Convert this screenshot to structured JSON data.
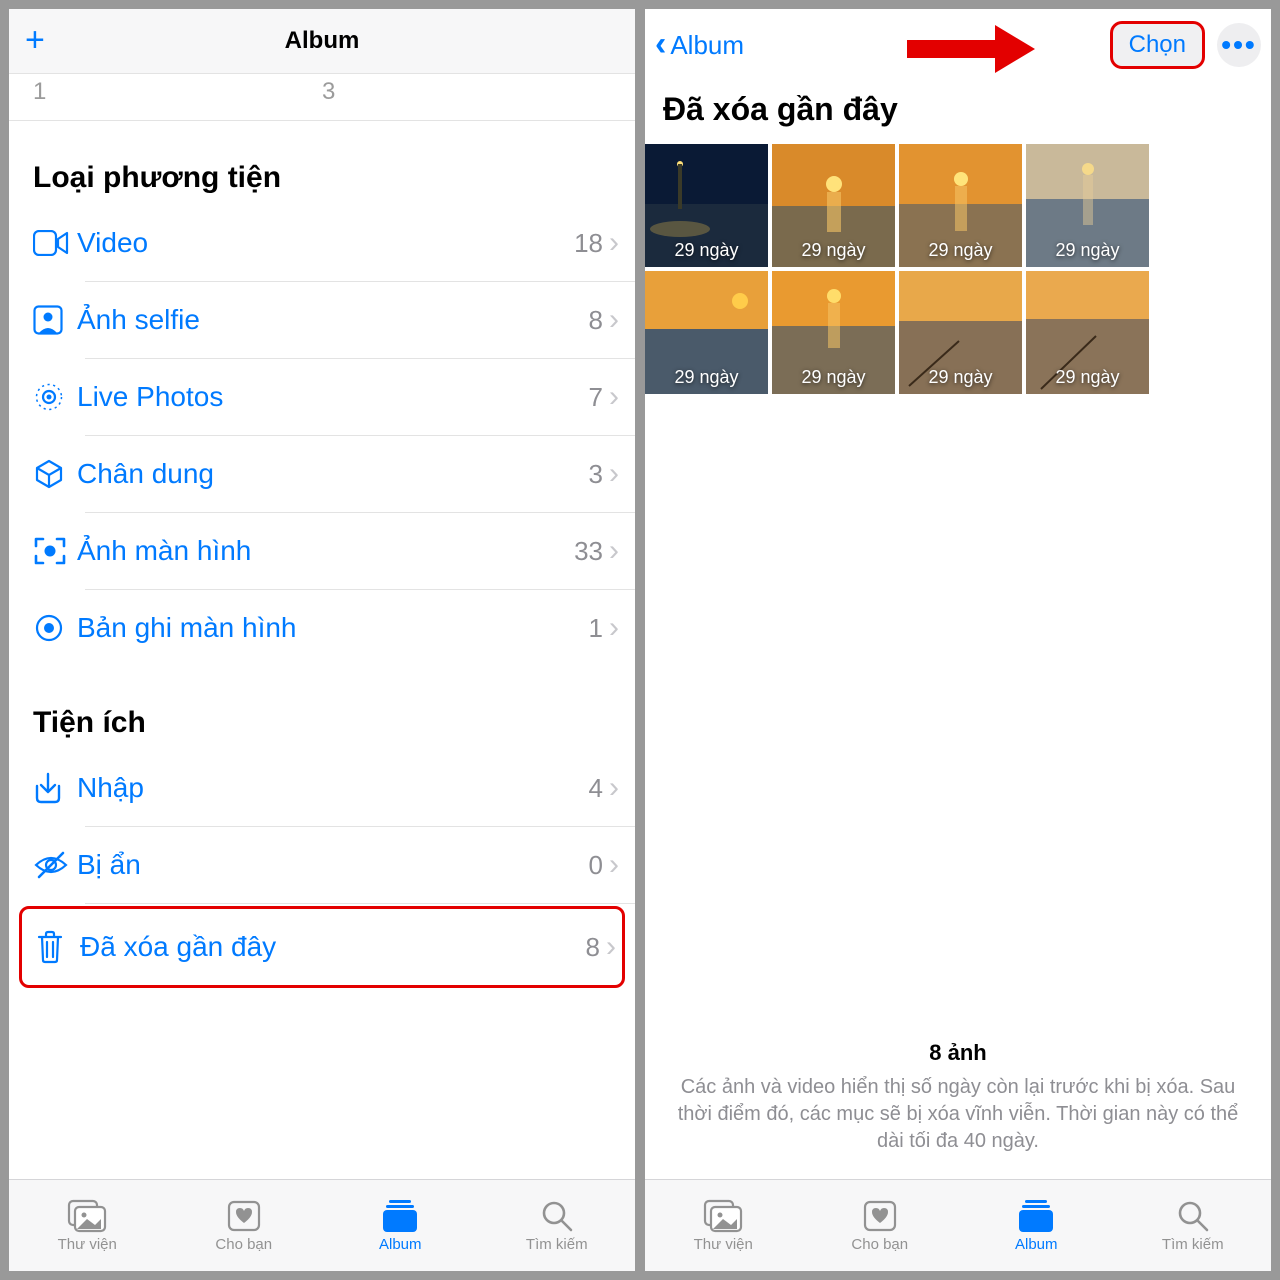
{
  "left": {
    "header_title": "Album",
    "row_small": {
      "a": "1",
      "b": "3"
    },
    "section_media": "Loại phương tiện",
    "media_rows": [
      {
        "label": "Video",
        "count": "18"
      },
      {
        "label": "Ảnh selfie",
        "count": "8"
      },
      {
        "label": "Live Photos",
        "count": "7"
      },
      {
        "label": "Chân dung",
        "count": "3"
      },
      {
        "label": "Ảnh màn hình",
        "count": "33"
      },
      {
        "label": "Bản ghi màn hình",
        "count": "1"
      }
    ],
    "section_util": "Tiện ích",
    "util_rows": [
      {
        "label": "Nhập",
        "count": "4"
      },
      {
        "label": "Bị ẩn",
        "count": "0"
      },
      {
        "label": "Đã xóa gần đây",
        "count": "8"
      }
    ]
  },
  "right": {
    "back_label": "Album",
    "select_label": "Chọn",
    "title": "Đã xóa gần đây",
    "thumbs": [
      "29 ngày",
      "29 ngày",
      "29 ngày",
      "29 ngày",
      "29 ngày",
      "29 ngày",
      "29 ngày",
      "29 ngày"
    ],
    "footer_count": "8 ảnh",
    "footer_desc": "Các ảnh và video hiển thị số ngày còn lại trước khi bị xóa. Sau thời điểm đó, các mục sẽ bị xóa vĩnh viễn. Thời gian này có thể dài tối đa 40 ngày."
  },
  "tabs": {
    "library": "Thư viện",
    "foryou": "Cho bạn",
    "album": "Album",
    "search": "Tìm kiếm"
  }
}
